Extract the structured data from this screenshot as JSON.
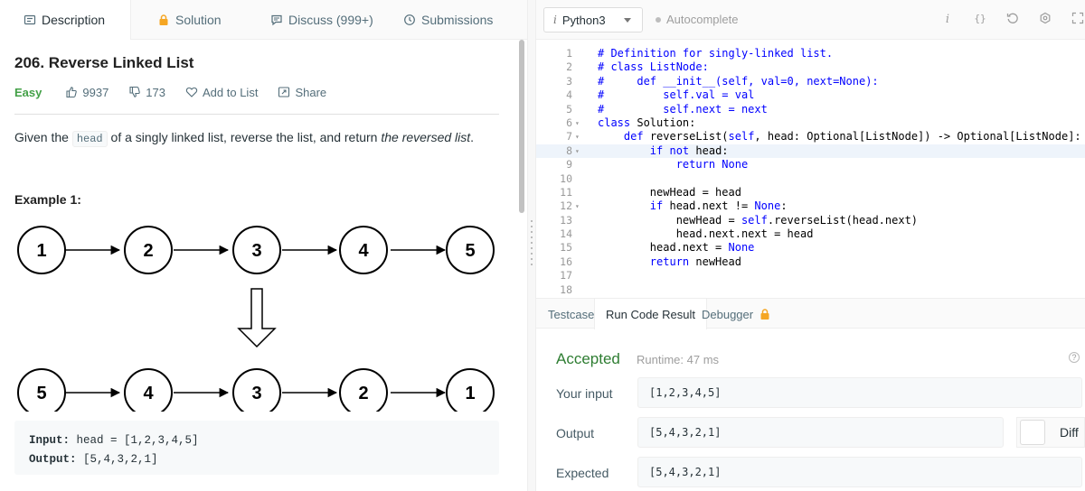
{
  "tabs": {
    "description": "Description",
    "solution": "Solution",
    "discuss": "Discuss (999+)",
    "submissions": "Submissions"
  },
  "problem": {
    "title": "206. Reverse Linked List",
    "difficulty": "Easy",
    "likes": "9937",
    "dislikes": "173",
    "add_to_list": "Add to List",
    "share": "Share",
    "desc_pre": "Given the ",
    "desc_code": "head",
    "desc_mid": " of a singly linked list, reverse the list, and return ",
    "desc_em": "the reversed list",
    "desc_post": ".",
    "example_title": "Example 1:",
    "diagram_top": [
      "1",
      "2",
      "3",
      "4",
      "5"
    ],
    "diagram_bottom": [
      "5",
      "4",
      "3",
      "2",
      "1"
    ],
    "example_input_label": "Input:",
    "example_input_value": " head = [1,2,3,4,5]",
    "example_output_label": "Output:",
    "example_output_value": " [5,4,3,2,1]"
  },
  "editor": {
    "language": "Python3",
    "lang_icon": "i",
    "autocomplete": "Autocomplete",
    "lines": [
      "# Definition for singly-linked list.",
      "# class ListNode:",
      "#     def __init__(self, val=0, next=None):",
      "#         self.val = val",
      "#         self.next = next",
      "class Solution:",
      "    def reverseList(self, head: Optional[ListNode]) -> Optional[ListNode]:",
      "        if not head:",
      "            return None",
      "",
      "        newHead = head",
      "        if head.next != None:",
      "            newHead = self.reverseList(head.next)",
      "            head.next.next = head",
      "        head.next = None",
      "        return newHead",
      "",
      ""
    ]
  },
  "result_tabs": {
    "testcase": "Testcase",
    "run_code_result": "Run Code Result",
    "debugger": "Debugger"
  },
  "result": {
    "status": "Accepted",
    "runtime": "Runtime: 47 ms",
    "input_label": "Your input",
    "input_value": "[1,2,3,4,5]",
    "output_label": "Output",
    "output_value": "[5,4,3,2,1]",
    "expected_label": "Expected",
    "expected_value": "[5,4,3,2,1]",
    "diff_label": "Diff"
  },
  "colors": {
    "accepted": "#2e7d32",
    "easy": "#43a047",
    "keyword": "#0000ff"
  }
}
